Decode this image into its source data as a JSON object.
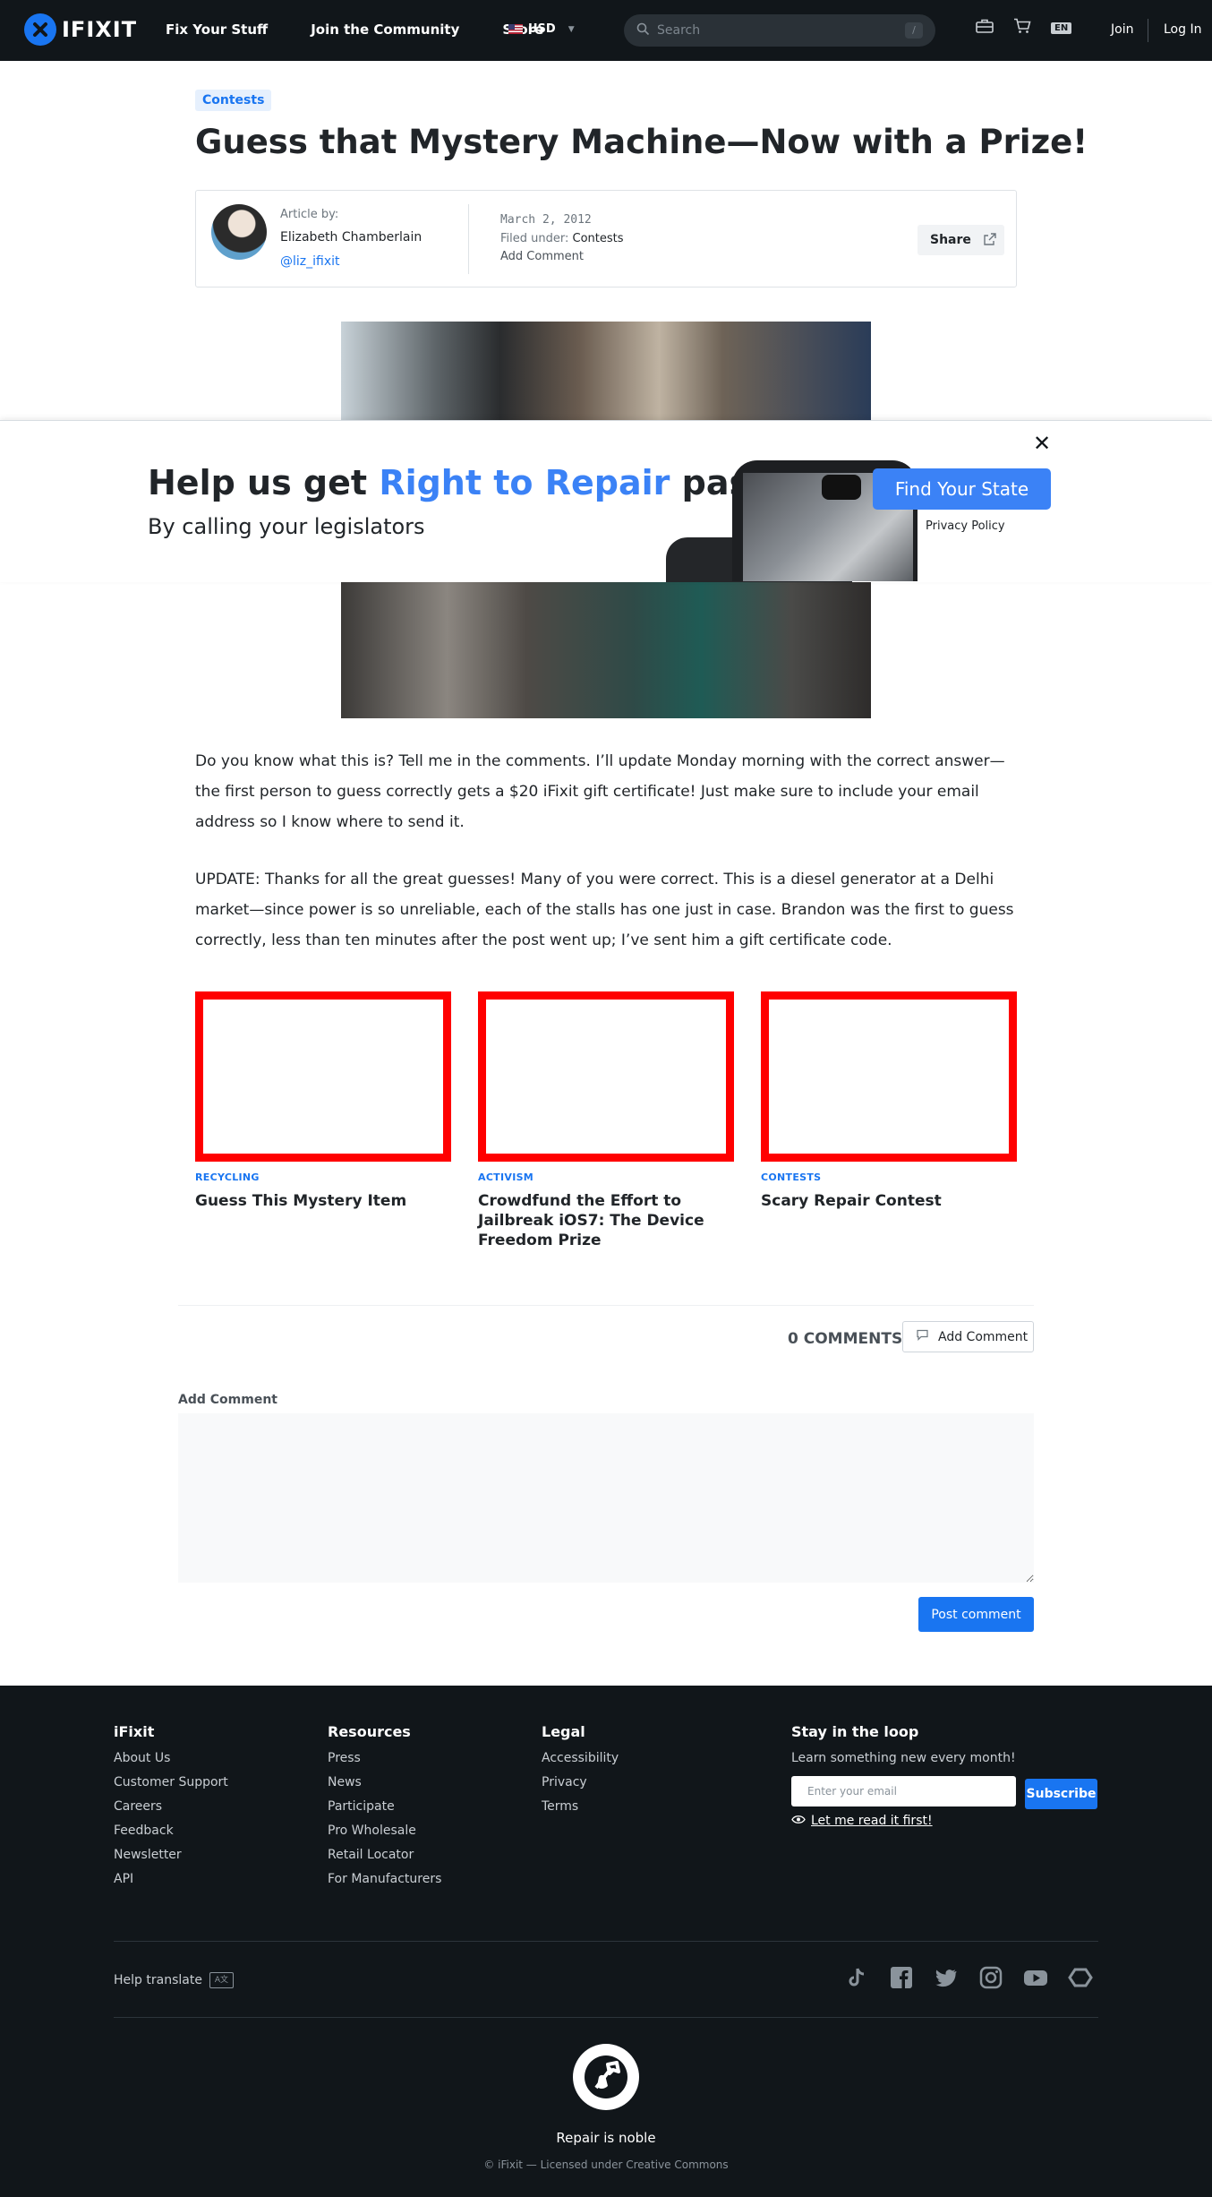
{
  "header": {
    "logo_text": "IFIXIT",
    "nav": [
      "Fix Your Stuff",
      "Join the Community",
      "Store"
    ],
    "currency": "USD",
    "search_placeholder": "Search",
    "search_shortcut": "/",
    "lang": "EN",
    "join": "Join",
    "login": "Log In"
  },
  "article": {
    "tag": "Contests",
    "title": "Guess that Mystery Machine—Now with a Prize!",
    "byline": {
      "label": "Article by:",
      "name": "Elizabeth Chamberlain",
      "handle": "@liz_ifixit",
      "date": "March 2, 2012",
      "filed_label": "Filed under: ",
      "filed_value": "Contests",
      "add_comment": "Add Comment",
      "share": "Share"
    },
    "paragraphs": [
      "Do you know what this is? Tell me in the comments. I’ll update Monday morning with the correct answer—the first person to guess correctly gets a $20 iFixit gift certificate! Just make sure to include your email address so I know where to send it.",
      "UPDATE: Thanks for all the great guesses! Many of you were correct. This is a diesel generator at a Delhi market—since power is so unreliable, each of the stalls has one just in case. Brandon was the first to guess correctly, less than ten minutes after the post went up; I’ve sent him a gift certificate code."
    ]
  },
  "related": [
    {
      "category": "RECYCLING",
      "title": "Guess This Mystery Item"
    },
    {
      "category": "ACTIVISM",
      "title": "Crowdfund the Effort to Jailbreak iOS7: The Device Freedom Prize"
    },
    {
      "category": "CONTESTS",
      "title": "Scary Repair Contest"
    }
  ],
  "comments": {
    "count_label": "0 COMMENTS",
    "add_button": "Add Comment",
    "form_label": "Add Comment",
    "post_button": "Post comment"
  },
  "banner": {
    "head_pre": "Help us get ",
    "head_highlight": "Right to Repair",
    "head_post": " passed",
    "sub": "By calling your legislators",
    "cta": "Find Your State",
    "privacy": "Privacy Policy",
    "close": "✕"
  },
  "footer": {
    "col1": {
      "title": "iFixit",
      "links": [
        "About Us",
        "Customer Support",
        "Careers",
        "Feedback",
        "Newsletter",
        "API"
      ]
    },
    "col2": {
      "title": "Resources",
      "links": [
        "Press",
        "News",
        "Participate",
        "Pro Wholesale",
        "Retail Locator",
        "For Manufacturers"
      ]
    },
    "col3": {
      "title": "Legal",
      "links": [
        "Accessibility",
        "Privacy",
        "Terms"
      ]
    },
    "loop": {
      "title": "Stay in the loop",
      "sub": "Learn something new every month!",
      "email_placeholder": "Enter your email",
      "subscribe": "Subscribe",
      "read_first": "Let me read it first!"
    },
    "help_translate": "Help translate",
    "slogan": "Repair is noble",
    "license": "© iFixit — Licensed under Creative Commons"
  },
  "colors": {
    "accent": "#1975f1",
    "banner_accent": "#3b82f6",
    "header_bg": "#11161a",
    "card_border": "#ff0000"
  }
}
